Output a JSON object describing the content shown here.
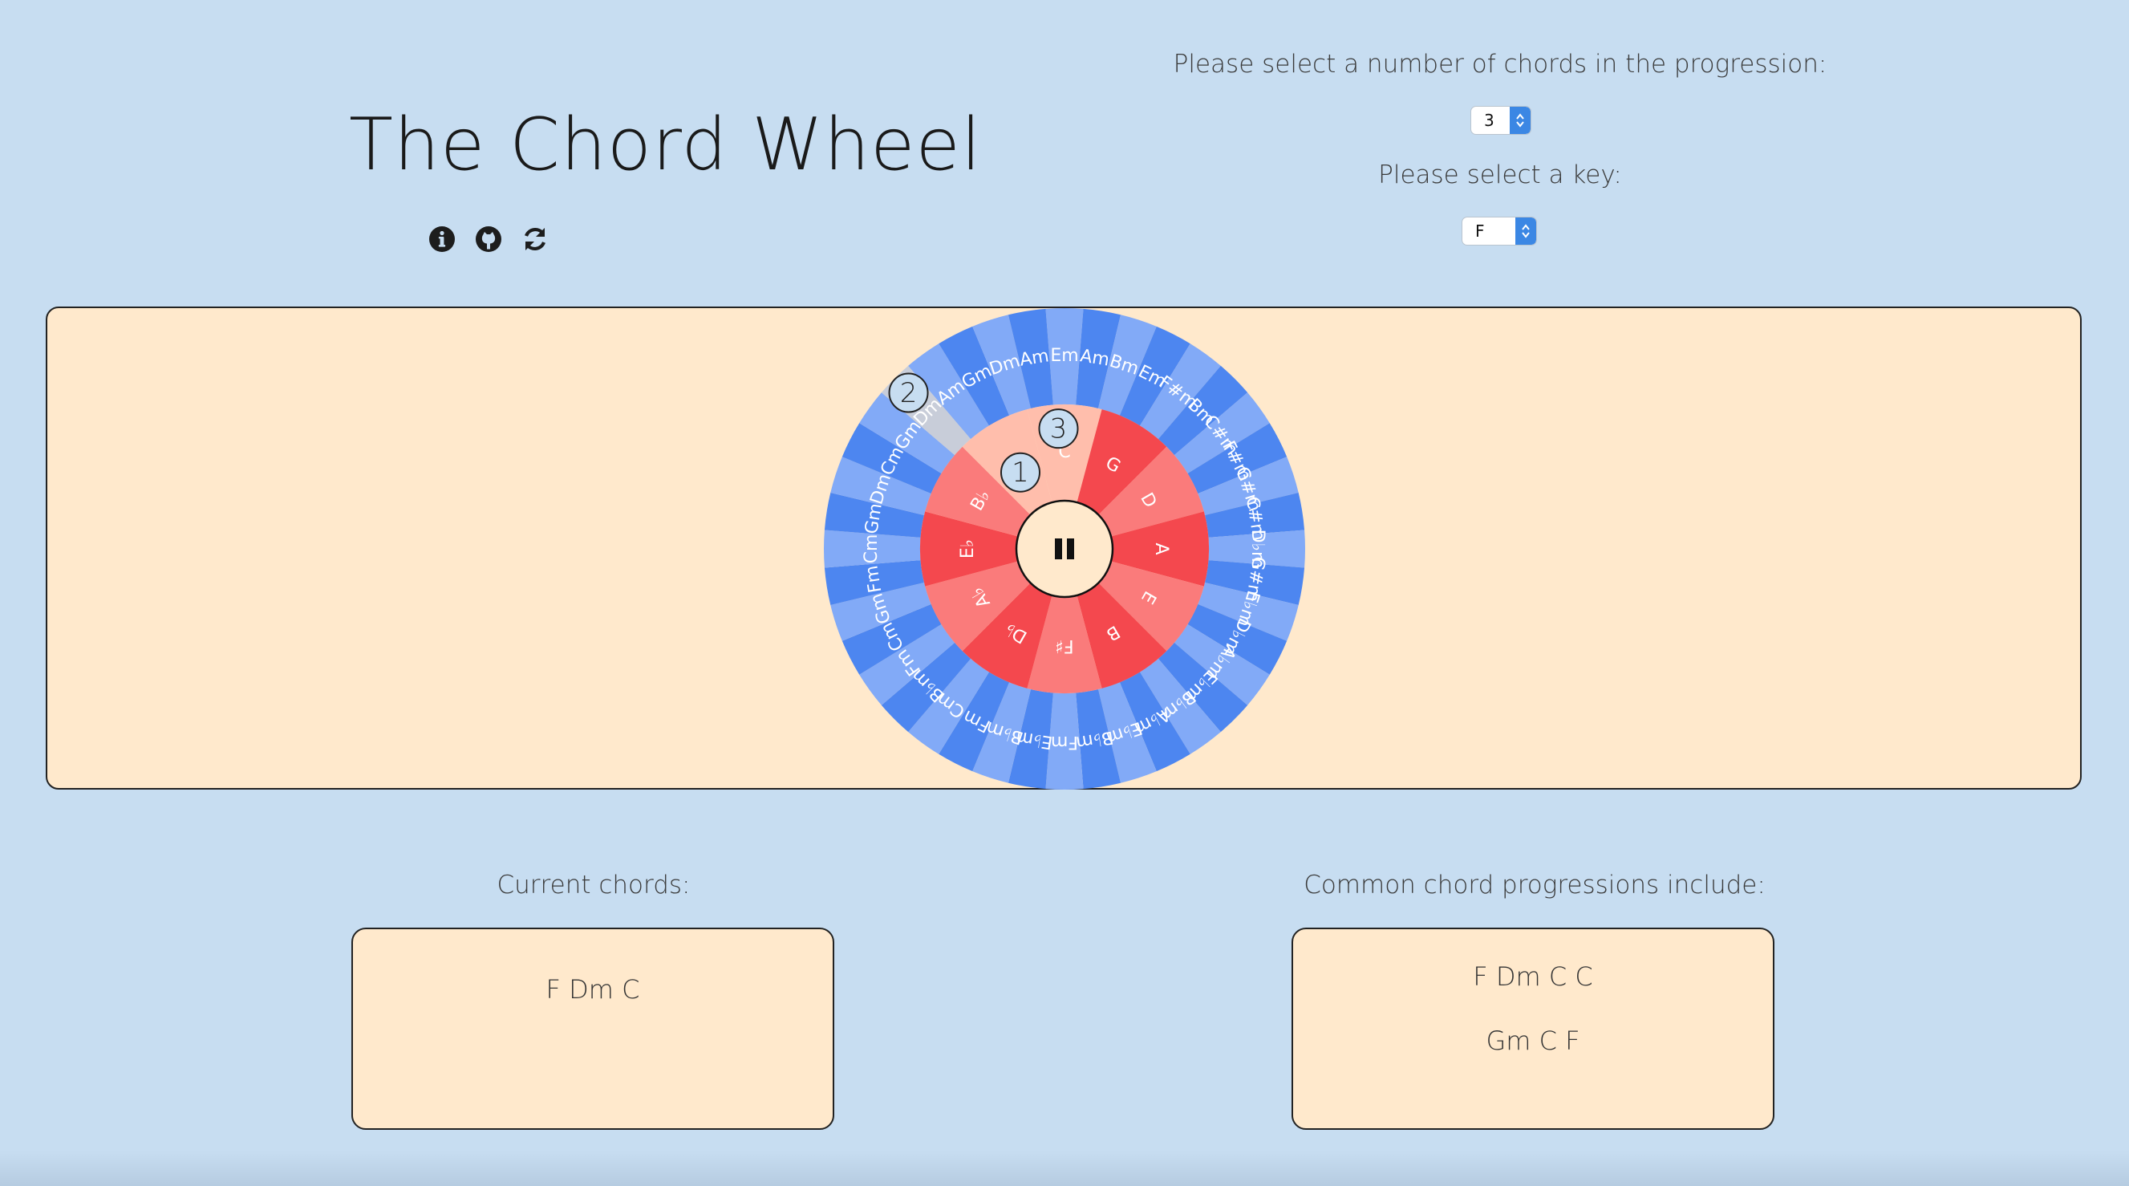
{
  "header": {
    "title": "The Chord Wheel",
    "icons": [
      "info-icon",
      "github-icon",
      "refresh-icon"
    ]
  },
  "controls": {
    "num_chords_prompt": "Please select a number of chords in the progression:",
    "num_chords_value": "3",
    "key_prompt": "Please select a key:",
    "key_value": "F"
  },
  "wheel": {
    "play_state_icon": "pause-icon",
    "outer_ring": [
      "Em",
      "Am",
      "Bm",
      "Em",
      "F#m",
      "Bm",
      "C#m",
      "F#m",
      "G#m",
      "C#m",
      "D♭m",
      "G#m",
      "E♭m",
      "D♭m",
      "A♭m",
      "E♭m",
      "B♭m",
      "A♭m",
      "E♭m",
      "B♭m",
      "Fm",
      "E♭m",
      "B♭m",
      "Fm",
      "Cm",
      "B♭m",
      "Fm",
      "Cm",
      "Gm",
      "Fm",
      "Cm",
      "Gm",
      "Dm",
      "Cm",
      "Gm",
      "Dm",
      "Am",
      "Gm",
      "Dm",
      "Am"
    ],
    "inner_ring": [
      "C",
      "G",
      "D",
      "A",
      "E",
      "B",
      "F♯",
      "D♭",
      "A♭",
      "E♭",
      "B♭",
      "F"
    ],
    "selected_markers": [
      "1",
      "2",
      "3"
    ],
    "colors": {
      "outer_light": "#82aaf7",
      "outer_dark": "#4d86f0",
      "outer_highlight": "#c8cdd9",
      "inner_light": "#fa7b7b",
      "inner_dark": "#f4484e",
      "inner_highlight": "#ffbeac",
      "center": "#ffe9cc"
    }
  },
  "current": {
    "label": "Current chords:",
    "chords": "F Dm C"
  },
  "common": {
    "label": "Common chord progressions include:",
    "progressions": [
      "F Dm C C",
      "Gm C F"
    ]
  }
}
